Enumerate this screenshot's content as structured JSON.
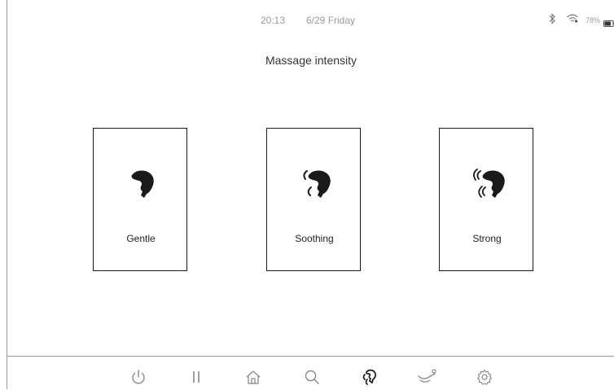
{
  "status": {
    "time": "20:13",
    "date": "6/29 Friday",
    "battery_percent": "78%",
    "battery_level": 0.78,
    "icons": [
      "bluetooth-icon",
      "wifi-icon",
      "battery-icon"
    ]
  },
  "title": "Massage intensity",
  "options": [
    {
      "label": "Gentle",
      "icon": "hand-gentle-icon",
      "wave_marks": 0
    },
    {
      "label": "Soothing",
      "icon": "hand-soothing-icon",
      "wave_marks": 1
    },
    {
      "label": "Strong",
      "icon": "hand-strong-icon",
      "wave_marks": 2
    }
  ],
  "nav": {
    "items": [
      {
        "name": "power-button",
        "icon": "power-icon"
      },
      {
        "name": "pause-button",
        "icon": "pause-icon"
      },
      {
        "name": "home-button",
        "icon": "home-icon"
      },
      {
        "name": "search-button",
        "icon": "search-icon"
      },
      {
        "name": "massage-hand-button",
        "icon": "massage-hand-icon",
        "active": true
      },
      {
        "name": "recline-button",
        "icon": "recline-chair-icon"
      },
      {
        "name": "settings-button",
        "icon": "gear-icon"
      }
    ]
  },
  "colors": {
    "text_primary": "#333333",
    "text_secondary": "#9a9a9a",
    "icon_dark": "#1a1a1a",
    "icon_light": "#888888"
  }
}
